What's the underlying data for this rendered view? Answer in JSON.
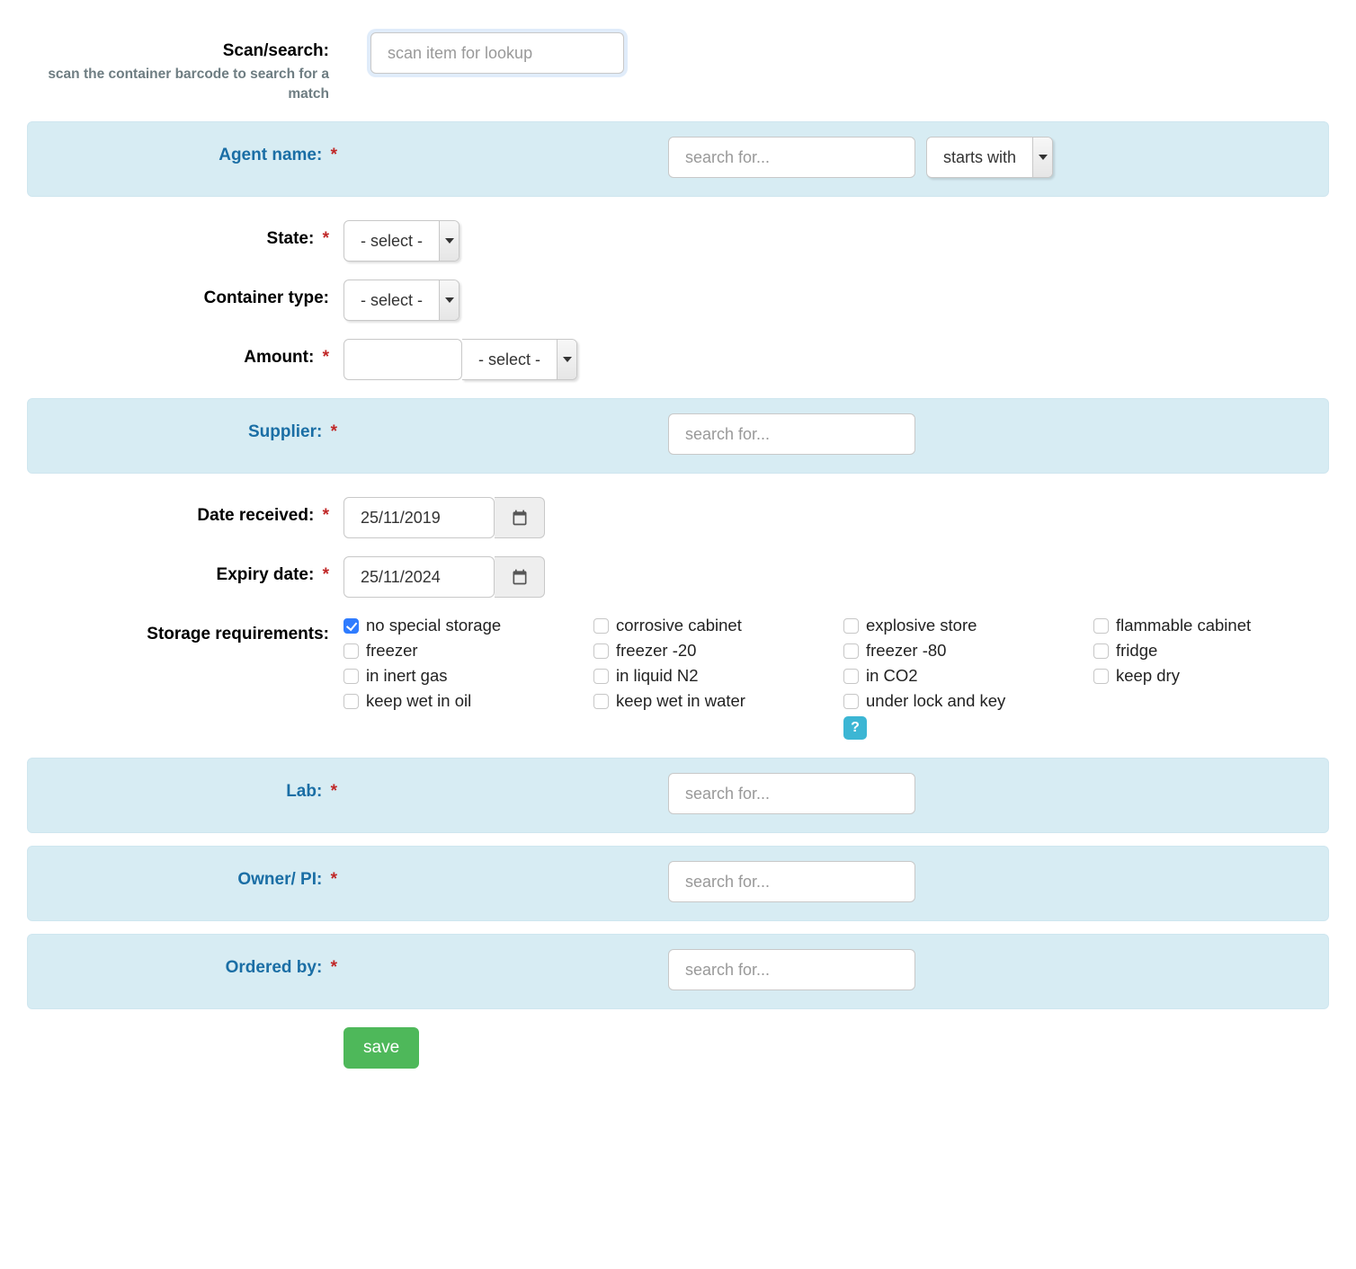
{
  "scan": {
    "label": "Scan/search:",
    "placeholder": "scan item for lookup",
    "hint": "scan the container barcode to search for a match"
  },
  "agent": {
    "label": "Agent name:",
    "placeholder": "search for...",
    "match_mode": "starts with"
  },
  "state": {
    "label": "State:",
    "value": "- select -"
  },
  "container_type": {
    "label": "Container type:",
    "value": "- select -"
  },
  "amount": {
    "label": "Amount:",
    "value": "",
    "unit": "- select -"
  },
  "supplier": {
    "label": "Supplier:",
    "placeholder": "search for..."
  },
  "date_received": {
    "label": "Date received:",
    "value": "25/11/2019"
  },
  "expiry_date": {
    "label": "Expiry date:",
    "value": "25/11/2024"
  },
  "storage": {
    "label": "Storage requirements:",
    "options": [
      {
        "label": "no special storage",
        "checked": true
      },
      {
        "label": "corrosive cabinet",
        "checked": false
      },
      {
        "label": "explosive store",
        "checked": false
      },
      {
        "label": "flammable cabinet",
        "checked": false
      },
      {
        "label": "freezer",
        "checked": false
      },
      {
        "label": "freezer -20",
        "checked": false
      },
      {
        "label": "freezer -80",
        "checked": false
      },
      {
        "label": "fridge",
        "checked": false
      },
      {
        "label": "in inert gas",
        "checked": false
      },
      {
        "label": "in liquid N2",
        "checked": false
      },
      {
        "label": "in CO2",
        "checked": false
      },
      {
        "label": "keep dry",
        "checked": false
      },
      {
        "label": "keep wet in oil",
        "checked": false
      },
      {
        "label": "keep wet in water",
        "checked": false
      },
      {
        "label": "under lock and key",
        "checked": false
      }
    ],
    "help": "?"
  },
  "lab": {
    "label": "Lab:",
    "placeholder": "search for..."
  },
  "owner": {
    "label": "Owner/ PI:",
    "placeholder": "search for..."
  },
  "ordered_by": {
    "label": "Ordered by:",
    "placeholder": "search for..."
  },
  "save_label": "save"
}
